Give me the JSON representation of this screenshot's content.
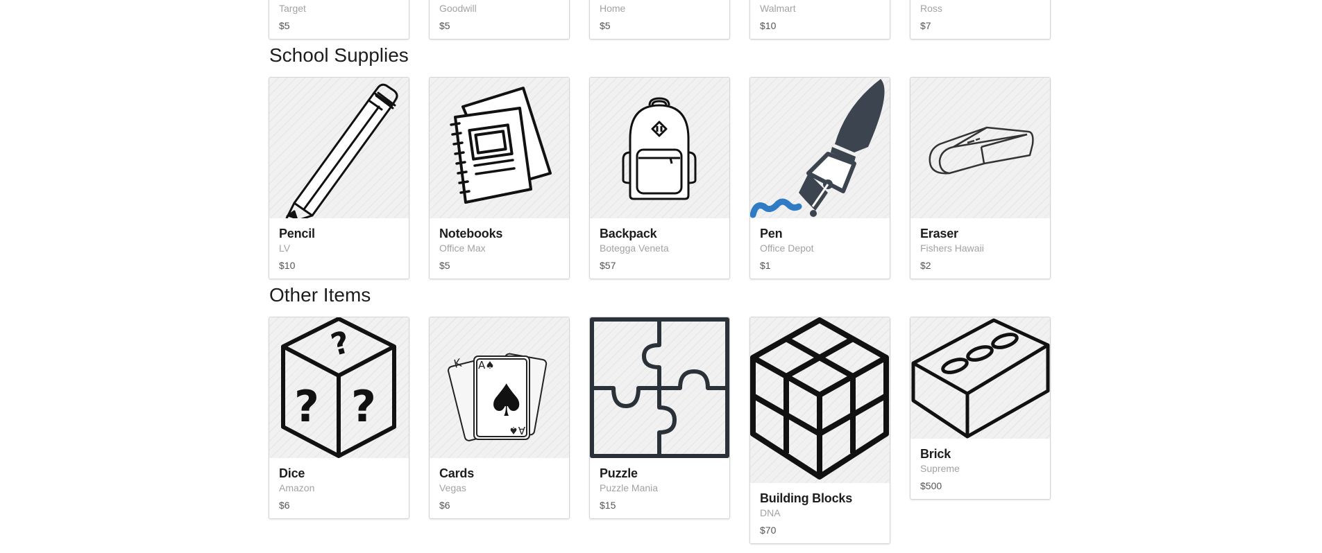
{
  "sections": [
    {
      "title": "",
      "items": [
        {
          "brand": "Target",
          "price": "$5"
        },
        {
          "brand": "Goodwill",
          "price": "$5"
        },
        {
          "brand": "Home",
          "price": "$5"
        },
        {
          "brand": "Walmart",
          "price": "$10"
        },
        {
          "brand": "Ross",
          "price": "$7"
        }
      ]
    },
    {
      "title": "School Supplies",
      "items": [
        {
          "name": "Pencil",
          "brand": "LV",
          "price": "$10",
          "icon": "pencil-icon"
        },
        {
          "name": "Notebooks",
          "brand": "Office Max",
          "price": "$5",
          "icon": "notebook-icon"
        },
        {
          "name": "Backpack",
          "brand": "Botegga Veneta",
          "price": "$57",
          "icon": "backpack-icon"
        },
        {
          "name": "Pen",
          "brand": "Office Depot",
          "price": "$1",
          "icon": "fountain-pen-icon"
        },
        {
          "name": "Eraser",
          "brand": "Fishers Hawaii",
          "price": "$2",
          "icon": "eraser-icon"
        }
      ]
    },
    {
      "title": "Other Items",
      "items": [
        {
          "name": "Dice",
          "brand": "Amazon",
          "price": "$6",
          "icon": "mystery-box-icon"
        },
        {
          "name": "Cards",
          "brand": "Vegas",
          "price": "$6",
          "icon": "playing-cards-icon"
        },
        {
          "name": "Puzzle",
          "brand": "Puzzle Mania",
          "price": "$15",
          "icon": "puzzle-icon"
        },
        {
          "name": "Building Blocks",
          "brand": "DNA",
          "price": "$70",
          "icon": "cube-grid-icon"
        },
        {
          "name": "Brick",
          "brand": "Supreme",
          "price": "$500",
          "icon": "brick-icon"
        }
      ]
    }
  ],
  "icon_colors": {
    "line": "#111111",
    "pen_body": "#3c4450",
    "pen_scribble": "#2f7bc4",
    "puzzle": "#2b3138"
  }
}
